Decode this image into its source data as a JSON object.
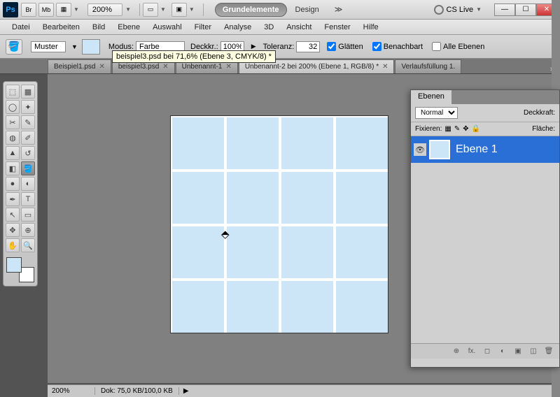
{
  "titlebar": {
    "ps": "Ps",
    "br": "Br",
    "mb": "Mb",
    "zoom": "200%",
    "workspace_active": "Grundelemente",
    "workspace_2": "Design",
    "chev": "≫",
    "cslive": "CS Live",
    "min": "—",
    "max": "☐",
    "close": "✕"
  },
  "menu": {
    "datei": "Datei",
    "bearbeiten": "Bearbeiten",
    "bild": "Bild",
    "ebene": "Ebene",
    "auswahl": "Auswahl",
    "filter": "Filter",
    "analyse": "Analyse",
    "_3d": "3D",
    "ansicht": "Ansicht",
    "fenster": "Fenster",
    "hilfe": "Hilfe"
  },
  "options": {
    "muster_label": "Muster",
    "modus_label": "Modus:",
    "modus_val": "Farbe",
    "deckkr_label": "Deckkr.:",
    "deckkr_val": "100%",
    "toleranz_label": "Toleranz:",
    "toleranz_val": "32",
    "glaetten": "Glätten",
    "benachbart": "Benachbart",
    "alle_ebenen": "Alle Ebenen",
    "tooltip": "beispiel3.psd bei 71,6% (Ebene 3, CMYK/8) *"
  },
  "tabs": {
    "t1": "Beispiel1.psd",
    "t2": "beispiel3.psd",
    "t3": "Unbenannt-1",
    "t4": "Unbenannt-2 bei 200% (Ebene 1, RGB/8) *",
    "t5": "Verlaufsfüllung 1.",
    "x": "✕",
    "chev": "»"
  },
  "status": {
    "zoom": "200%",
    "doc": "Dok: 75,0 KB/100,0 KB",
    "arr": "▶"
  },
  "layers": {
    "tab": "Ebenen",
    "mode": "Normal",
    "deckkraft": "Deckkraft:",
    "fixieren": "Fixieren:",
    "flaeche": "Fläche:",
    "layer1": "Ebene 1",
    "eye": "👁",
    "link": "⊕",
    "fx": "fx.",
    "mask": "◻",
    "adj": "◐",
    "grp": "▣",
    "new": "◫",
    "del": "🗑"
  }
}
